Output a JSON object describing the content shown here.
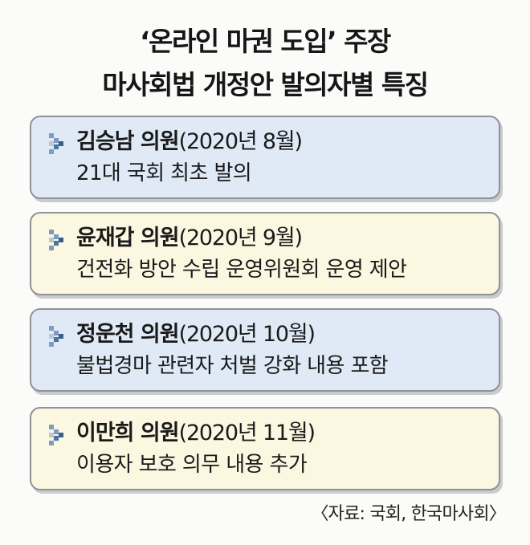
{
  "title": {
    "line1": "‘온라인 마권 도입’ 주장",
    "line2": "마사회법 개정안 발의자별 특징"
  },
  "items": [
    {
      "name": "김승남 의원",
      "date": "(2020년 8월)",
      "desc": "21대 국회 최초 발의",
      "bg": "#dfeaf6"
    },
    {
      "name": "윤재갑 의원",
      "date": "(2020년 9월)",
      "desc": "건전화 방안 수립 운영위원회 운영 제안",
      "bg": "#fcf7e0"
    },
    {
      "name": "정운천 의원",
      "date": "(2020년 10월)",
      "desc": "불법경마 관련자 처벌 강화 내용 포함",
      "bg": "#dfeaf6"
    },
    {
      "name": "이만희 의원",
      "date": "(2020년 11월)",
      "desc": "이용자 보호 의무 내용 추가",
      "bg": "#fcf7e0"
    }
  ],
  "bullet_icon": "checkered-arrow-icon",
  "bullet_colors": [
    "#6d8fb7",
    "#3a5f8f"
  ],
  "source": "〈자료: 국회, 한국마사회〉"
}
